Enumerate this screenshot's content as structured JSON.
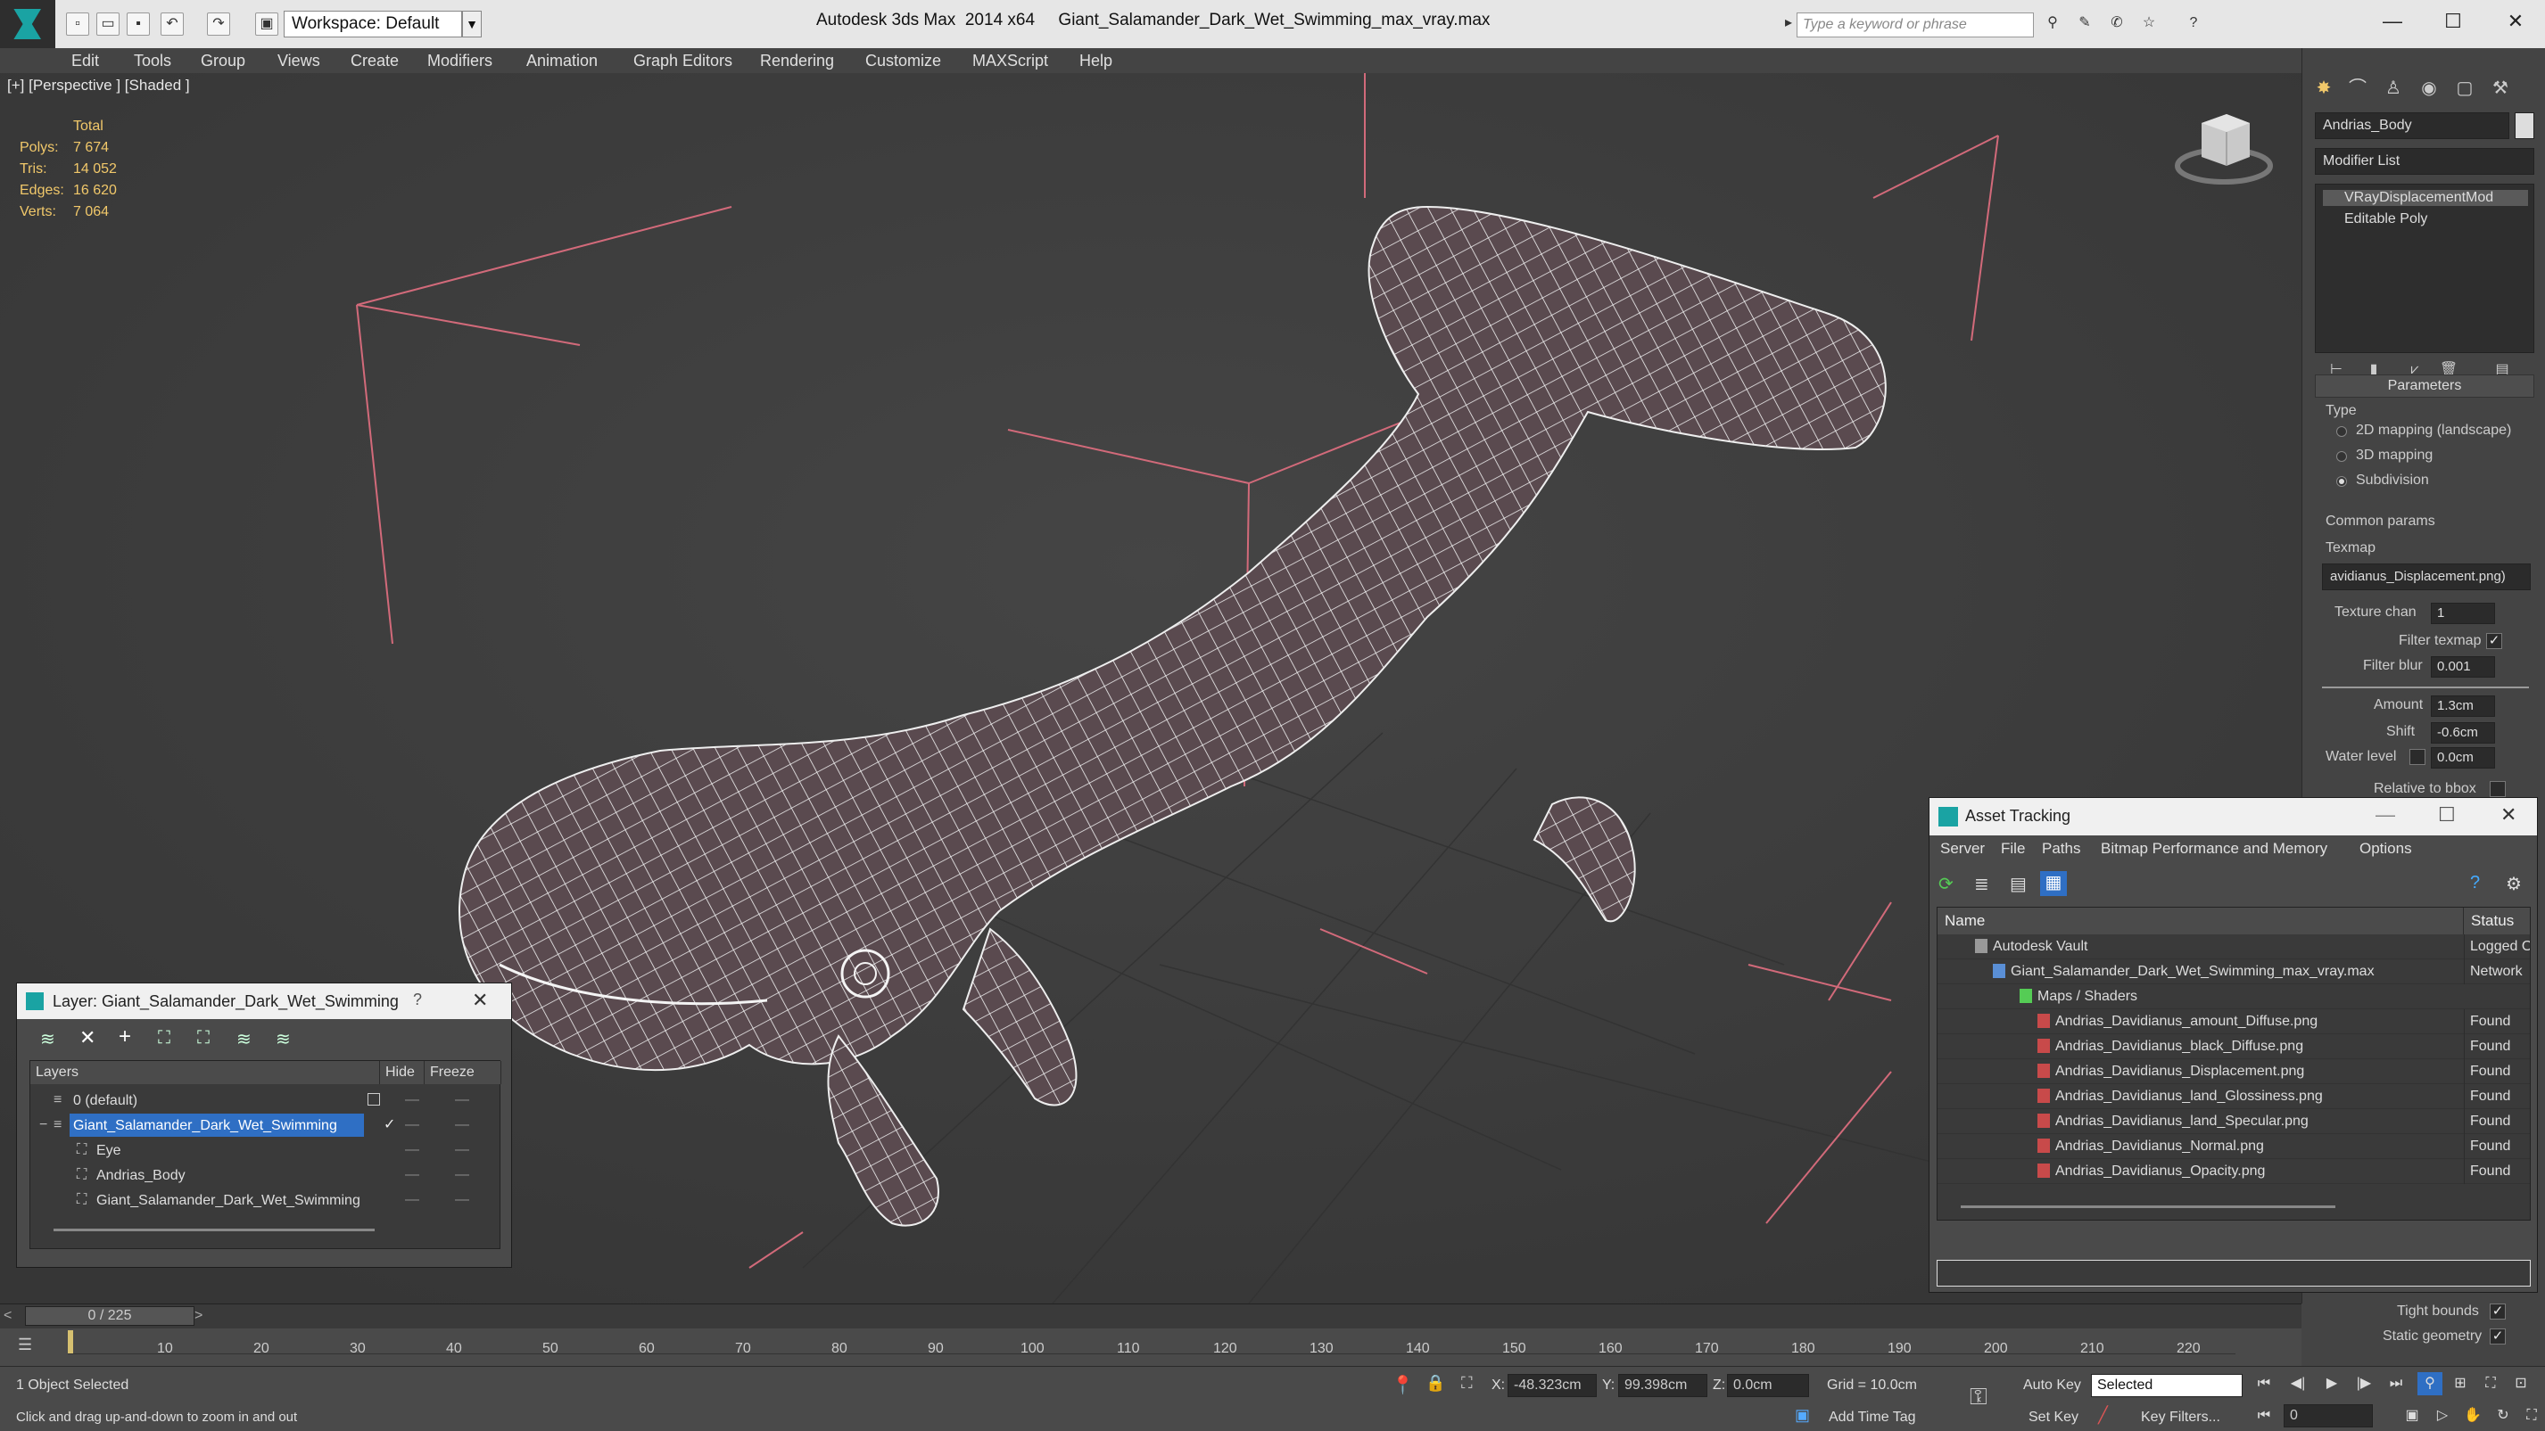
{
  "titlebar": {
    "workspace": "Workspace: Default",
    "app_title": "Autodesk 3ds Max  2014 x64     Giant_Salamander_Dark_Wet_Swimming_max_vray.max",
    "search_placeholder": "Type a keyword or phrase"
  },
  "menu": [
    "Edit",
    "Tools",
    "Group",
    "Views",
    "Create",
    "Modifiers",
    "Animation",
    "Graph Editors",
    "Rendering",
    "Customize",
    "MAXScript",
    "Help"
  ],
  "viewport": {
    "label": "[+] [Perspective ] [Shaded ]",
    "stats": {
      "header": "Total",
      "polys_label": "Polys:",
      "polys": "7 674",
      "tris_label": "Tris:",
      "tris": "14 052",
      "edges_label": "Edges:",
      "edges": "16 620",
      "verts_label": "Verts:",
      "verts": "7 064"
    }
  },
  "command_panel": {
    "object_name": "Andrias_Body",
    "modifier_list": "Modifier List",
    "stack": [
      "VRayDisplacementMod",
      "Editable Poly"
    ],
    "parameters": "Parameters",
    "type_label": "Type",
    "type_options": [
      "2D mapping (landscape)",
      "3D mapping",
      "Subdivision"
    ],
    "common_params": "Common params",
    "texmap_label": "Texmap",
    "texmap_value": "avidianus_Displacement.png)",
    "texture_chan_label": "Texture chan",
    "texture_chan": "1",
    "filter_texmap": "Filter texmap",
    "filter_blur_label": "Filter blur",
    "filter_blur": "0.001",
    "amount_label": "Amount",
    "amount": "1.3cm",
    "shift_label": "Shift",
    "shift": "-0.6cm",
    "water_level_label": "Water level",
    "water_level": "0.0cm",
    "relative_bbox": "Relative to bbox",
    "tight_bounds": "Tight bounds",
    "static_geometry": "Static geometry"
  },
  "layer_dialog": {
    "title": "Layer: Giant_Salamander_Dark_Wet_Swimming",
    "help": "?",
    "columns": {
      "layers": "Layers",
      "hide": "Hide",
      "freeze": "Freeze"
    },
    "rows": [
      {
        "name": "0 (default)"
      },
      {
        "name": "Giant_Salamander_Dark_Wet_Swimming"
      },
      {
        "name": "Eye"
      },
      {
        "name": "Andrias_Body"
      },
      {
        "name": "Giant_Salamander_Dark_Wet_Swimming"
      }
    ]
  },
  "asset_tracking": {
    "title": "Asset Tracking",
    "menu": [
      "Server",
      "File",
      "Paths",
      "Bitmap Performance and Memory",
      "Options"
    ],
    "columns": {
      "name": "Name",
      "status": "Status"
    },
    "rows": [
      {
        "name": "Autodesk Vault",
        "status": "Logged O"
      },
      {
        "name": "Giant_Salamander_Dark_Wet_Swimming_max_vray.max",
        "status": "Network"
      },
      {
        "name": "Maps / Shaders",
        "status": ""
      },
      {
        "name": "Andrias_Davidianus_amount_Diffuse.png",
        "status": "Found"
      },
      {
        "name": "Andrias_Davidianus_black_Diffuse.png",
        "status": "Found"
      },
      {
        "name": "Andrias_Davidianus_Displacement.png",
        "status": "Found"
      },
      {
        "name": "Andrias_Davidianus_land_Glossiness.png",
        "status": "Found"
      },
      {
        "name": "Andrias_Davidianus_land_Specular.png",
        "status": "Found"
      },
      {
        "name": "Andrias_Davidianus_Normal.png",
        "status": "Found"
      },
      {
        "name": "Andrias_Davidianus_Opacity.png",
        "status": "Found"
      }
    ]
  },
  "timeline": {
    "frame_counter": "0 / 225",
    "ticks": [
      "10",
      "20",
      "30",
      "40",
      "50",
      "60",
      "70",
      "80",
      "90",
      "100",
      "110",
      "120",
      "130",
      "140",
      "150",
      "160",
      "170",
      "180",
      "190",
      "200",
      "210",
      "220"
    ]
  },
  "status": {
    "selection": "1 Object Selected",
    "prompt": "Click and drag up-and-down to zoom in and out",
    "x_label": "X:",
    "x": "-48.323cm",
    "y_label": "Y:",
    "y": "99.398cm",
    "z_label": "Z:",
    "z": "0.0cm",
    "grid": "Grid = 10.0cm",
    "add_time_tag": "Add Time Tag",
    "auto_key": "Auto Key",
    "set_key": "Set Key",
    "key_mode": "Selected",
    "key_filters": "Key Filters...",
    "current_frame": "0"
  }
}
